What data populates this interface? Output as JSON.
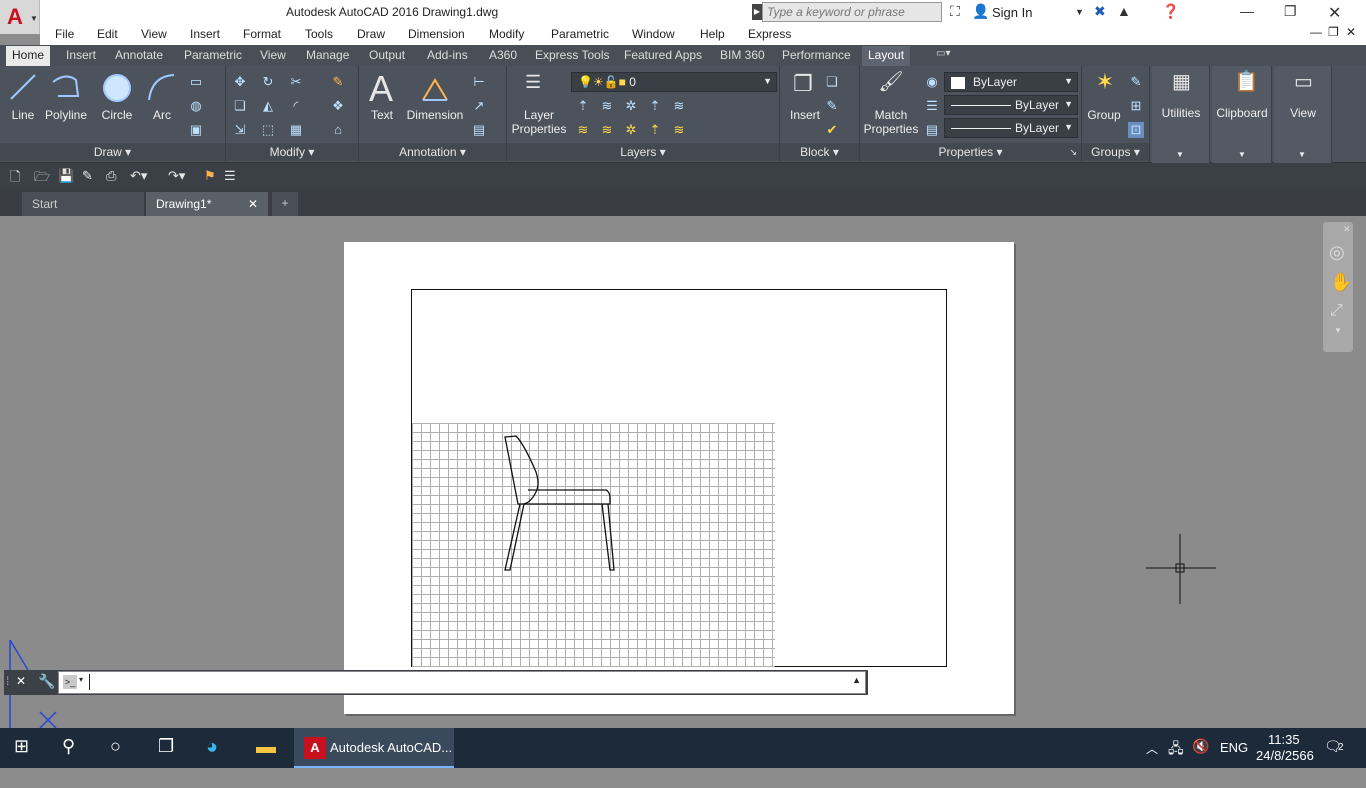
{
  "window": {
    "title": "Autodesk AutoCAD 2016    Drawing1.dwg",
    "search_placeholder": "Type a keyword or phrase",
    "sign_in": "Sign In"
  },
  "menu": [
    "File",
    "Edit",
    "View",
    "Insert",
    "Format",
    "Tools",
    "Draw",
    "Dimension",
    "Modify",
    "Parametric",
    "Window",
    "Help",
    "Express"
  ],
  "ribbon_tabs": [
    "Home",
    "Insert",
    "Annotate",
    "Parametric",
    "View",
    "Manage",
    "Output",
    "Add-ins",
    "A360",
    "Express Tools",
    "Featured Apps",
    "BIM 360",
    "Performance",
    "Layout"
  ],
  "draw": {
    "title": "Draw",
    "line": "Line",
    "polyline": "Polyline",
    "circle": "Circle",
    "arc": "Arc"
  },
  "modify": {
    "title": "Modify"
  },
  "annotation": {
    "title": "Annotation",
    "text": "Text",
    "dimension": "Dimension"
  },
  "layers": {
    "title": "Layers",
    "layer_properties": "Layer\nProperties",
    "current_layer": "0"
  },
  "block": {
    "title": "Block",
    "insert": "Insert"
  },
  "properties": {
    "title": "Properties",
    "match": "Match\nProperties",
    "color": "ByLayer",
    "linetype": "ByLayer",
    "lineweight": "ByLayer"
  },
  "groups": {
    "title": "Groups",
    "group": "Group"
  },
  "utilities": {
    "label": "Utilities"
  },
  "clipboard": {
    "label": "Clipboard"
  },
  "view": {
    "label": "View"
  },
  "doc_tabs": {
    "start": "Start",
    "drawing": "Drawing1*",
    "add": "+"
  },
  "taskbar": {
    "app": "Autodesk AutoCAD...",
    "lang": "ENG",
    "time": "11:35",
    "date": "24/8/2566",
    "notif": "2"
  },
  "colors": {
    "ribbon_bg": "#4c535c",
    "autocad_red": "#c8101e",
    "taskbar": "#1c2a3a"
  }
}
